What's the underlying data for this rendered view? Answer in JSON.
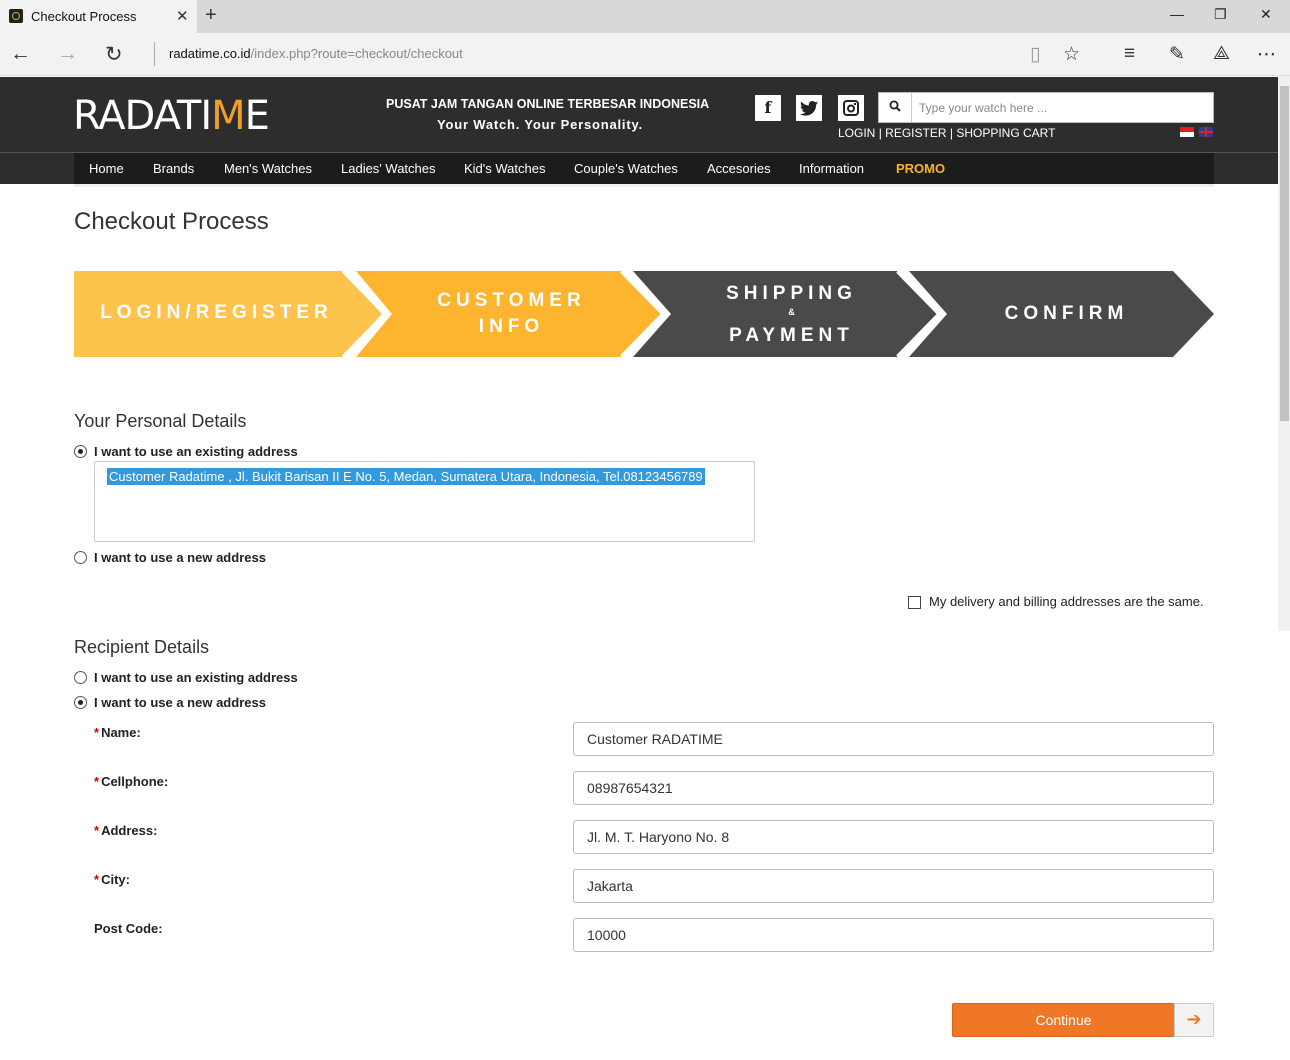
{
  "browser": {
    "tab_title": "Checkout Process",
    "tab_close": "✕",
    "new_tab": "+",
    "url_domain": "radatime.co.id",
    "url_rest": "/index.php?route=checkout/checkout",
    "minimize": "—",
    "restore": "❐",
    "close": "✕"
  },
  "header": {
    "logo_text_a": "RADATI",
    "logo_text_m": "M",
    "logo_text_e": "E",
    "tagline_1": "PUSAT JAM TANGAN ONLINE TERBESAR INDONESIA",
    "tagline_2": "Your Watch. Your Personality.",
    "search_placeholder": "Type your watch here ...",
    "links": {
      "login": "LOGIN",
      "register": "REGISTER",
      "cart": "SHOPPING CART",
      "sep": "|"
    },
    "social": {
      "facebook": "f",
      "twitter": "t",
      "instagram": "◙"
    }
  },
  "nav": {
    "items": [
      "Home",
      "Brands",
      "Men's Watches",
      "Ladies' Watches",
      "Kid's Watches",
      "Couple's Watches",
      "Accesories",
      "Information"
    ],
    "promo": "PROMO"
  },
  "page_title": "Checkout Process",
  "steps": {
    "step1": "LOGIN/REGISTER",
    "step2_line1": "CUSTOMER",
    "step2_line2": "INFO",
    "step3_line1": "SHIPPING",
    "step3_amp": "&",
    "step3_line2": "PAYMENT",
    "step4": "CONFIRM",
    "colors": {
      "active": "#fdb530",
      "active_light": "#fdc34d",
      "inactive": "#4a4a4a"
    }
  },
  "personal": {
    "title": "Your Personal Details",
    "existing_label": "I want to use an existing address",
    "existing_checked": true,
    "selected_address": "Customer Radatime , Jl. Bukit Barisan II E No. 5, Medan, Sumatera Utara, Indonesia, Tel.08123456789",
    "new_label": "I want to use a new address",
    "same_address_label": "My delivery and billing addresses are the same."
  },
  "recipient": {
    "title": "Recipient Details",
    "existing_label": "I want to use an existing address",
    "new_label": "I want to use a new address",
    "new_checked": true,
    "required_mark": "*",
    "fields": {
      "name_label": "Name:",
      "name_value": "Customer RADATIME",
      "cellphone_label": "Cellphone:",
      "cellphone_value": "08987654321",
      "address_label": "Address:",
      "address_value": "Jl. M. T. Haryono No. 8",
      "city_label": "City:",
      "city_value": "Jakarta",
      "postcode_label": "Post Code:",
      "postcode_value": "10000"
    }
  },
  "continue_label": "Continue",
  "continue_arrow": "➔"
}
